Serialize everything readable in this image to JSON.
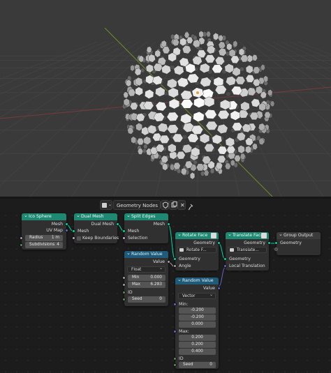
{
  "header": {
    "tree_name": "Geometry Nodes"
  },
  "nodes": {
    "ico_sphere": {
      "title": "Ico Sphere",
      "out_mesh": "Mesh",
      "out_uvmap": "UV Map",
      "radius_label": "Radius",
      "radius_value": "1 m",
      "subdiv_label": "Subdivisions",
      "subdiv_value": "4"
    },
    "dual_mesh": {
      "title": "Dual Mesh",
      "out_dual": "Dual Mesh",
      "in_mesh": "Mesh",
      "keep_boundaries": "Keep Boundaries"
    },
    "split_edges": {
      "title": "Split Edges",
      "out_mesh": "Mesh",
      "in_mesh": "Mesh",
      "in_selection": "Selection"
    },
    "random_value_1": {
      "title": "Random Value",
      "out_value": "Value",
      "type": "Float",
      "min_label": "Min",
      "min_value": "0.000",
      "max_label": "Max",
      "max_value": "6.283",
      "id_label": "ID",
      "seed_label": "Seed",
      "seed_value": "0"
    },
    "rotate_face": {
      "title": "Rotate Face",
      "out_geometry": "Geometry",
      "group_name": "Rotate F...",
      "in_geometry": "Geometry",
      "in_angle": "Angle"
    },
    "random_value_2": {
      "title": "Random Value",
      "out_value": "Value",
      "type": "Vector",
      "min_label": "Min:",
      "min_values": [
        "-0.200",
        "-0.200",
        "0.000"
      ],
      "max_label": "Max:",
      "max_values": [
        "0.200",
        "0.200",
        "0.400"
      ],
      "id_label": "ID",
      "seed_label": "Seed",
      "seed_value": "0"
    },
    "translate_face": {
      "title": "Translate Face",
      "out_geometry": "Geometry",
      "group_name": "Translate...",
      "in_geometry": "Geometry",
      "in_translation": "Local Translation"
    },
    "group_output": {
      "title": "Group Output",
      "in_geometry": "Geometry"
    }
  },
  "colors": {
    "geometry_header": "#1e8872",
    "utility_header": "#1f5b78",
    "geometry_socket": "#00d6a3",
    "vector_socket": "#6363c7",
    "float_socket": "#a1a1a1",
    "viewport_bg": "#3a3a3a",
    "editor_bg": "#1c1c1c"
  },
  "icons": [
    "geometry-nodes-editor-icon",
    "shield-icon",
    "duplicate-icon",
    "close-icon",
    "pin-icon",
    "node-group-icon",
    "chevron-down-icon"
  ]
}
